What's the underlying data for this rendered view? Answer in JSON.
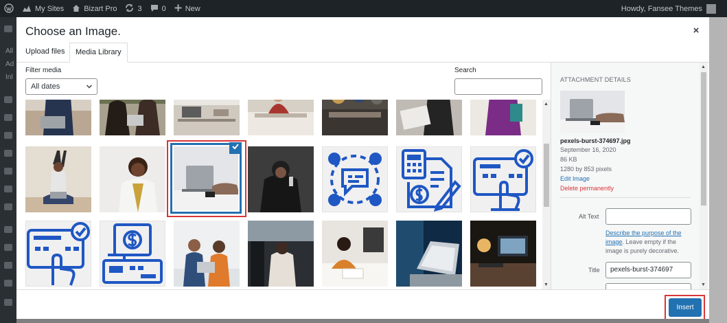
{
  "admin_bar": {
    "items": [
      {
        "icon": "wordpress-icon",
        "label": ""
      },
      {
        "icon": "my-sites-icon",
        "label": "My Sites"
      },
      {
        "icon": "home-icon",
        "label": "Bizart Pro"
      },
      {
        "icon": "updates-icon",
        "label": "3"
      },
      {
        "icon": "comments-icon",
        "label": "0"
      },
      {
        "icon": "plus-icon",
        "label": "New"
      }
    ],
    "greeting": "Howdy, Fansee Themes"
  },
  "admin_menu": {
    "labels": [
      "All",
      "Ad",
      "Inl"
    ]
  },
  "modal": {
    "title": "Choose an Image.",
    "close_glyph": "×",
    "tabs": [
      {
        "label": "Upload files",
        "active": false
      },
      {
        "label": "Media Library",
        "active": true
      }
    ],
    "filter": {
      "label": "Filter media",
      "selected": "All dates"
    },
    "search": {
      "label": "Search",
      "value": ""
    },
    "grid": {
      "selected_index": 9,
      "items": [
        {
          "type": "photo",
          "subject": "woman with laptop on couch",
          "partial": true
        },
        {
          "type": "photo",
          "subject": "two women with laptop",
          "partial": true
        },
        {
          "type": "photo",
          "subject": "office desk",
          "partial": true
        },
        {
          "type": "photo",
          "subject": "man at desk",
          "partial": true
        },
        {
          "type": "photo",
          "subject": "group meeting",
          "partial": true
        },
        {
          "type": "photo",
          "subject": "man with documents",
          "partial": true
        },
        {
          "type": "photo",
          "subject": "woman in purple",
          "partial": true
        },
        {
          "type": "photo",
          "subject": "woman stretching with laptop"
        },
        {
          "type": "photo",
          "subject": "smiling woman"
        },
        {
          "type": "photo",
          "subject": "hands on laptop",
          "selected": true
        },
        {
          "type": "photo",
          "subject": "woman on phone"
        },
        {
          "type": "icon",
          "subject": "team communication"
        },
        {
          "type": "icon",
          "subject": "invoice calculator"
        },
        {
          "type": "icon",
          "subject": "payment terminal checkmark"
        },
        {
          "type": "icon",
          "subject": "payment terminal hand"
        },
        {
          "type": "icon",
          "subject": "cash register dollar"
        },
        {
          "type": "photo",
          "subject": "two men with laptop"
        },
        {
          "type": "photo",
          "subject": "woman in car"
        },
        {
          "type": "photo",
          "subject": "woman writing at desk"
        },
        {
          "type": "photo",
          "subject": "laptop on table"
        },
        {
          "type": "photo",
          "subject": "desk setup"
        }
      ]
    },
    "details": {
      "heading": "Attachment Details",
      "filename": "pexels-burst-374697.jpg",
      "date": "September 16, 2020",
      "filesize": "86 KB",
      "dimensions": "1280 by 853 pixels",
      "edit_link": "Edit Image",
      "delete_link": "Delete permanently",
      "alt_label": "Alt Text",
      "alt_value": "",
      "alt_help_link": "Describe the purpose of the image",
      "alt_help_text": ". Leave empty if the image is purely decorative.",
      "title_label": "Title",
      "title_value": "pexels-burst-374697"
    },
    "insert_label": "Insert"
  },
  "colors": {
    "accent": "#2271b1",
    "danger": "#d63638",
    "icon_blue": "#1f57c3"
  }
}
